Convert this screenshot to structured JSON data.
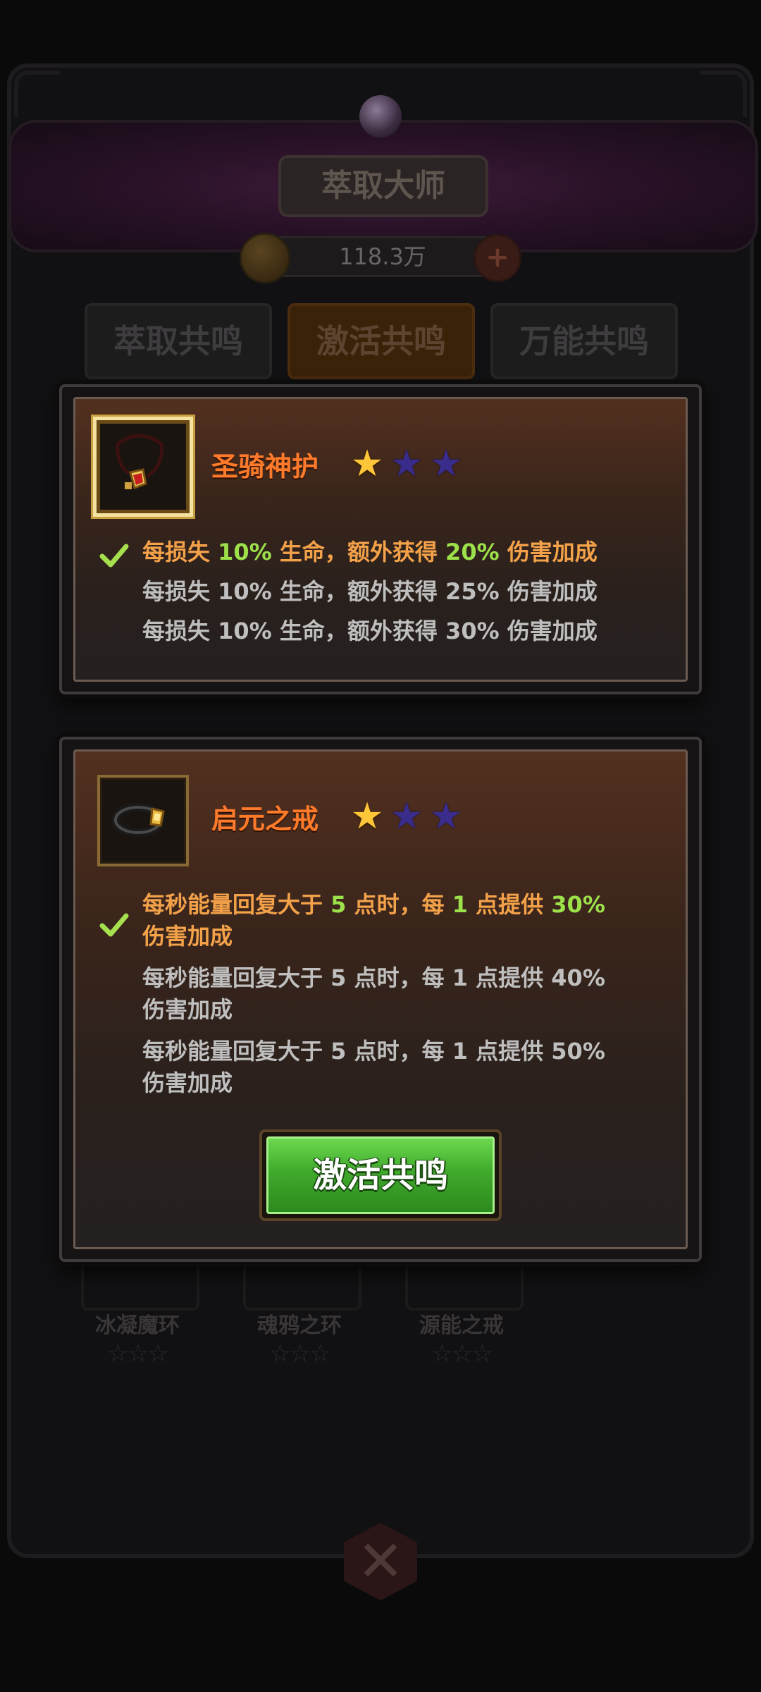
{
  "background": {
    "title": "萃取大师",
    "currency": "118.3万",
    "tabs": [
      "萃取共鸣",
      "激活共鸣",
      "万能共鸣"
    ],
    "items": [
      {
        "name": "冰凝魔环",
        "stars": "☆☆☆"
      },
      {
        "name": "魂鸦之环",
        "stars": "☆☆☆"
      },
      {
        "name": "源能之戒",
        "stars": "☆☆☆"
      }
    ]
  },
  "card1": {
    "item_icon": "necklace-icon",
    "title": "圣骑神护",
    "stars_filled": 1,
    "stars_total": 3,
    "effects": [
      {
        "active": true,
        "p1": "每损失 ",
        "v1": "10%",
        "p2": " 生命，额外获得 ",
        "v2": "20%",
        "p3": " 伤害加成"
      },
      {
        "active": false,
        "p1": "每损失 ",
        "v1": "10%",
        "p2": " 生命，额外获得 ",
        "v2": "25%",
        "p3": " 伤害加成"
      },
      {
        "active": false,
        "p1": "每损失 ",
        "v1": "10%",
        "p2": " 生命，额外获得 ",
        "v2": "30%",
        "p3": " 伤害加成"
      }
    ]
  },
  "card2": {
    "item_icon": "ring-icon",
    "title": "启元之戒",
    "stars_filled": 1,
    "stars_total": 3,
    "effects": [
      {
        "active": true,
        "p1": "每秒能量回复大于 ",
        "v1": "5",
        "p2": " 点时，每 ",
        "v2": "1",
        "p3": " 点提供 ",
        "v3": "30%",
        "line2": "伤害加成"
      },
      {
        "active": false,
        "p1": "每秒能量回复大于 ",
        "v1": "5",
        "p2": " 点时，每 ",
        "v2": "1",
        "p3": " 点提供 ",
        "v3": "40%",
        "line2": "伤害加成"
      },
      {
        "active": false,
        "p1": "每秒能量回复大于 ",
        "v1": "5",
        "p2": " 点时，每 ",
        "v2": "1",
        "p3": " 点提供 ",
        "v3": "50%",
        "line2": "伤害加成"
      }
    ],
    "button_label": "激活共鸣"
  },
  "colors": {
    "title_orange": "#ff7a2a",
    "active_text": "#f4a24a",
    "highlight_green": "#9ce04a",
    "inactive_text": "#bfbfbf",
    "button_green": "#3faa2c"
  }
}
